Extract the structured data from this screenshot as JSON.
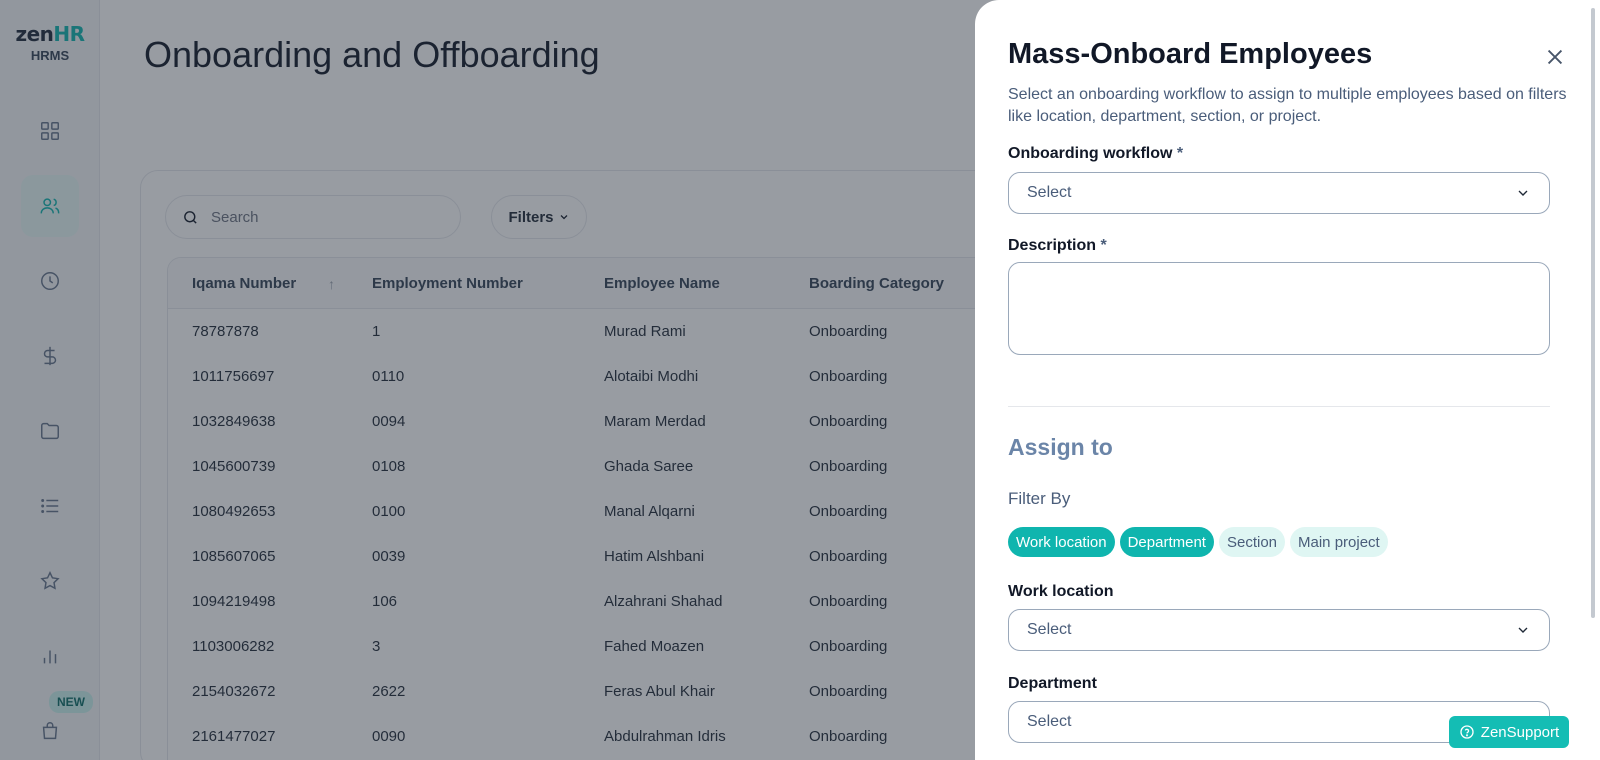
{
  "app": {
    "brand_main": "zen",
    "brand_accent": "HR",
    "brand_sub": "HRMS",
    "accent_color": "#0fb5ae"
  },
  "sidebar": {
    "items": [
      {
        "icon": "dashboard-grid-icon",
        "active": false
      },
      {
        "icon": "people-icon",
        "active": true
      },
      {
        "icon": "clock-icon",
        "active": false
      },
      {
        "icon": "dollar-icon",
        "active": false
      },
      {
        "icon": "folder-icon",
        "active": false
      },
      {
        "icon": "list-icon",
        "active": false
      },
      {
        "icon": "star-icon",
        "active": false
      },
      {
        "icon": "bar-chart-icon",
        "active": false
      },
      {
        "icon": "shopping-bag-icon",
        "active": false
      }
    ],
    "new_badge": "NEW"
  },
  "page": {
    "title": "Onboarding and Offboarding"
  },
  "toolbar": {
    "search_placeholder": "Search",
    "filters_label": "Filters"
  },
  "table": {
    "columns": [
      "Iqama Number",
      "Employment Number",
      "Employee Name",
      "Boarding Category"
    ],
    "rows": [
      [
        "78787878",
        "1",
        "Murad Rami",
        "Onboarding"
      ],
      [
        "1011756697",
        "0110",
        "Alotaibi Modhi",
        "Onboarding"
      ],
      [
        "1032849638",
        "0094",
        "Maram Merdad",
        "Onboarding"
      ],
      [
        "1045600739",
        "0108",
        "Ghada Saree",
        "Onboarding"
      ],
      [
        "1080492653",
        "0100",
        "Manal Alqarni",
        "Onboarding"
      ],
      [
        "1085607065",
        "0039",
        "Hatim Alshbani",
        "Onboarding"
      ],
      [
        "1094219498",
        "106",
        "Alzahrani Shahad",
        "Onboarding"
      ],
      [
        "1103006282",
        "3",
        "Fahed Moazen",
        "Onboarding"
      ],
      [
        "2154032672",
        "2622",
        "Feras Abul Khair",
        "Onboarding"
      ],
      [
        "2161477027",
        "0090",
        "Abdulrahman Idris",
        "Onboarding"
      ]
    ]
  },
  "drawer": {
    "title": "Mass-Onboard Employees",
    "description": "Select an onboarding workflow to assign to multiple employees based on filters like location, department, section, or project.",
    "workflow_label": "Onboarding workflow",
    "required_mark": "*",
    "workflow_value": "Select",
    "description_label": "Description",
    "assign_title": "Assign to",
    "filter_by": "Filter By",
    "chips": [
      {
        "label": "Work location",
        "active": true
      },
      {
        "label": "Department",
        "active": true
      },
      {
        "label": "Section",
        "active": false
      },
      {
        "label": "Main project",
        "active": false
      }
    ],
    "work_location_label": "Work location",
    "work_location_value": "Select",
    "department_label": "Department",
    "department_value": "Select"
  },
  "support": {
    "label": "ZenSupport"
  }
}
